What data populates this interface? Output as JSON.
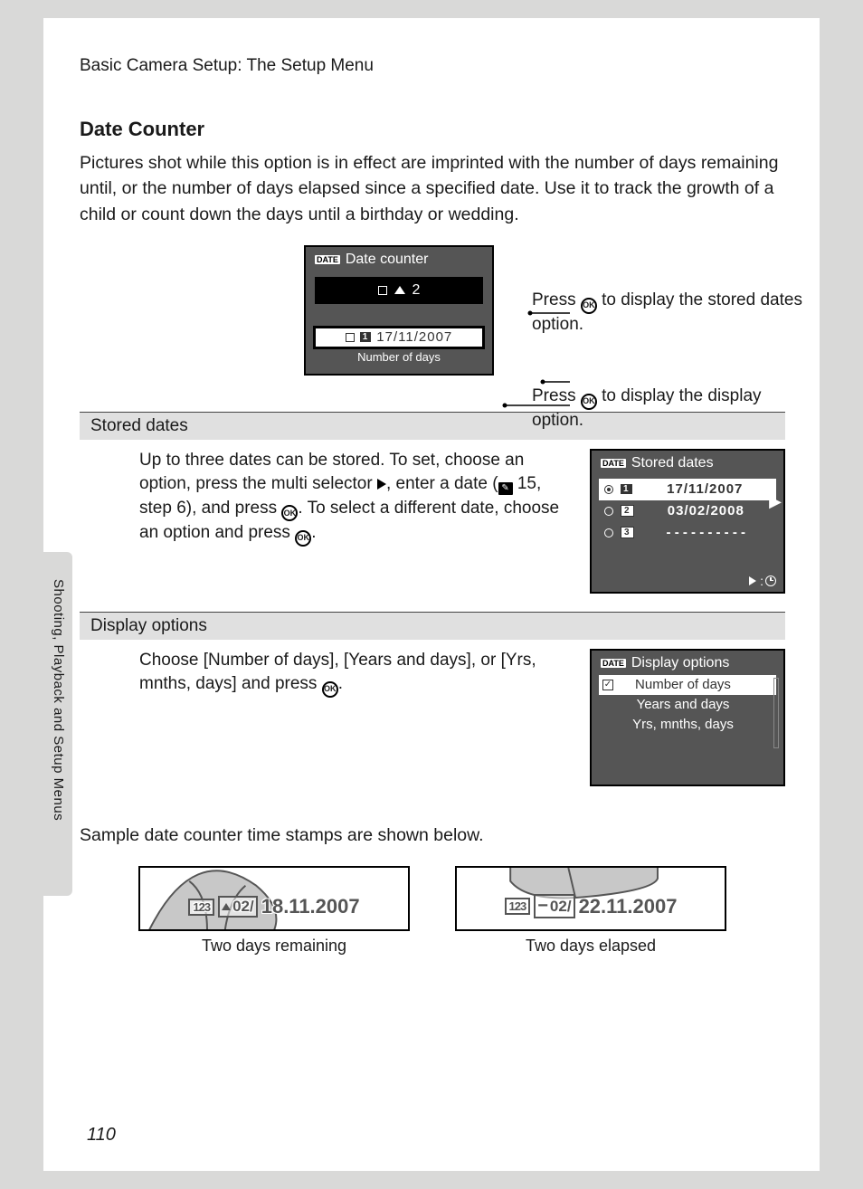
{
  "breadcrumb": "Basic Camera Setup: The Setup Menu",
  "heading": "Date Counter",
  "intro": "Pictures shot while this option is in effect are imprinted with the number of days remaining until, or the number of days elapsed since a specified date. Use it to track the growth of a child or count down the days until a birthday or wedding.",
  "lcd1": {
    "title": "Date counter",
    "date_badge": "DATE",
    "row1_num": "2",
    "row2_num": "1",
    "row2_date": "17/11/2007",
    "bottom_label": "Number of days"
  },
  "callouts": {
    "c1a": "Press ",
    "c1b": " to display the stored dates option.",
    "c2a": "Press ",
    "c2b": " to display the display option."
  },
  "stored": {
    "header": "Stored dates",
    "text_a": "Up to three dates can be stored. To set, choose an option, press the multi selector ",
    "text_b": ", enter a date (",
    "text_c": " 15, step 6), and press ",
    "text_d": ". To select a different date, choose an option and press ",
    "text_e": ".",
    "lcd_title": "Stored  dates",
    "rows": [
      {
        "num": "1",
        "date": "17/11/2007",
        "selected": true
      },
      {
        "num": "2",
        "date": "03/02/2008",
        "selected": false
      },
      {
        "num": "3",
        "date": "- - - - - - - - - -",
        "selected": false
      }
    ]
  },
  "display": {
    "header": "Display options",
    "text_a": "Choose [Number of days], [Years and days], or [Yrs, mnths, days] and press ",
    "text_b": ".",
    "lcd_title": "Display options",
    "options": [
      {
        "label": "Number of days",
        "selected": true
      },
      {
        "label": "Years and days",
        "selected": false
      },
      {
        "label": "Yrs, mnths, days",
        "selected": false
      }
    ]
  },
  "sample_intro": "Sample date counter time stamps are shown below.",
  "samples": {
    "s1": {
      "tag": "123",
      "counter": "02/",
      "date": "18.11.2007",
      "caption": "Two days remaining"
    },
    "s2": {
      "tag": "123",
      "counter": "02/",
      "date": "22.11.2007",
      "caption": "Two days elapsed"
    }
  },
  "side_text": "Shooting, Playback and Setup Menus",
  "page_number": "110",
  "ok_text": "OK"
}
